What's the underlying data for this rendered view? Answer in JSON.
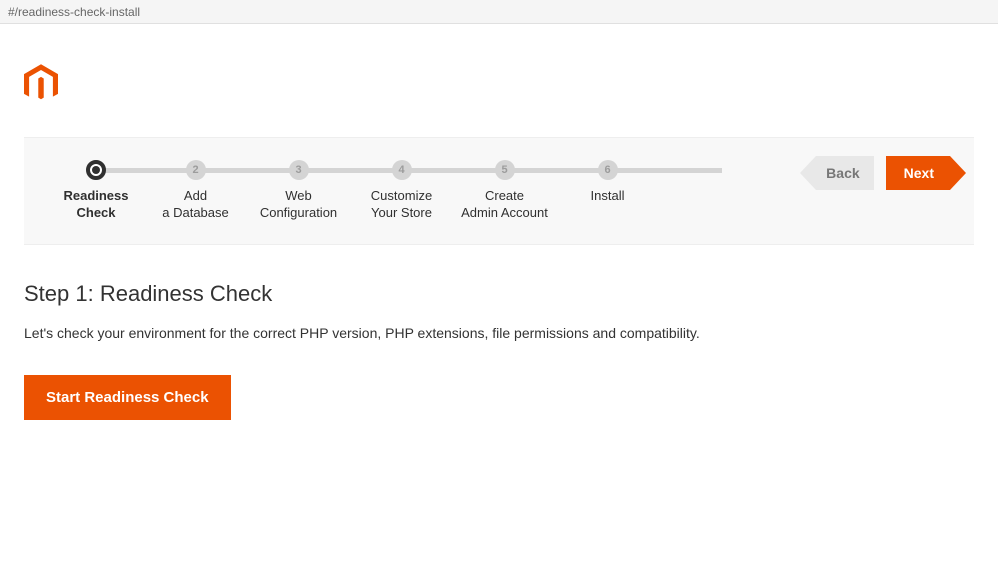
{
  "url_fragment": "#/readiness-check-install",
  "colors": {
    "brand": "#eb5202"
  },
  "wizard": {
    "steps": [
      {
        "num": "1",
        "label": "Readiness\nCheck",
        "current": true
      },
      {
        "num": "2",
        "label": "Add\na Database",
        "current": false
      },
      {
        "num": "3",
        "label": "Web\nConfiguration",
        "current": false
      },
      {
        "num": "4",
        "label": "Customize\nYour Store",
        "current": false
      },
      {
        "num": "5",
        "label": "Create\nAdmin Account",
        "current": false
      },
      {
        "num": "6",
        "label": "Install",
        "current": false
      }
    ],
    "back_label": "Back",
    "next_label": "Next"
  },
  "content": {
    "title": "Step 1: Readiness Check",
    "description": "Let's check your environment for the correct PHP version, PHP extensions, file permissions and compatibility.",
    "start_button": "Start Readiness Check"
  }
}
